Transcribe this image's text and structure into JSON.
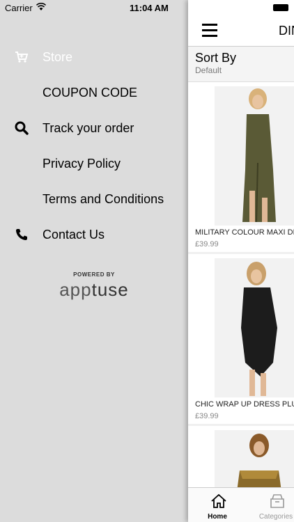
{
  "status": {
    "carrier": "Carrier",
    "time": "11:04 AM"
  },
  "menu": [
    {
      "label": "Store",
      "icon": "cart-icon",
      "active": true
    },
    {
      "label": "COUPON CODE"
    },
    {
      "label": "Track your order",
      "icon": "search-icon"
    },
    {
      "label": "Privacy Policy"
    },
    {
      "label": "Terms and Conditions"
    },
    {
      "label": "Contact Us",
      "icon": "phone-icon"
    }
  ],
  "powered": {
    "by": "POWERED BY",
    "brand_app": "app",
    "brand_tuse": "tuse"
  },
  "navbar": {
    "title": "DIN"
  },
  "sort": {
    "title": "Sort By",
    "value": "Default"
  },
  "products": [
    {
      "name": "MILITARY COLOUR MAXI DR",
      "price": "£39.99",
      "color": "#5a5a36"
    },
    {
      "name": "CHIC WRAP UP DRESS PLU",
      "price": "£39.99",
      "color": "#1c1c1c"
    },
    {
      "name": "",
      "price": "",
      "color": "#8a6a2a"
    }
  ],
  "tabs": {
    "home": "Home",
    "categories": "Categories"
  }
}
